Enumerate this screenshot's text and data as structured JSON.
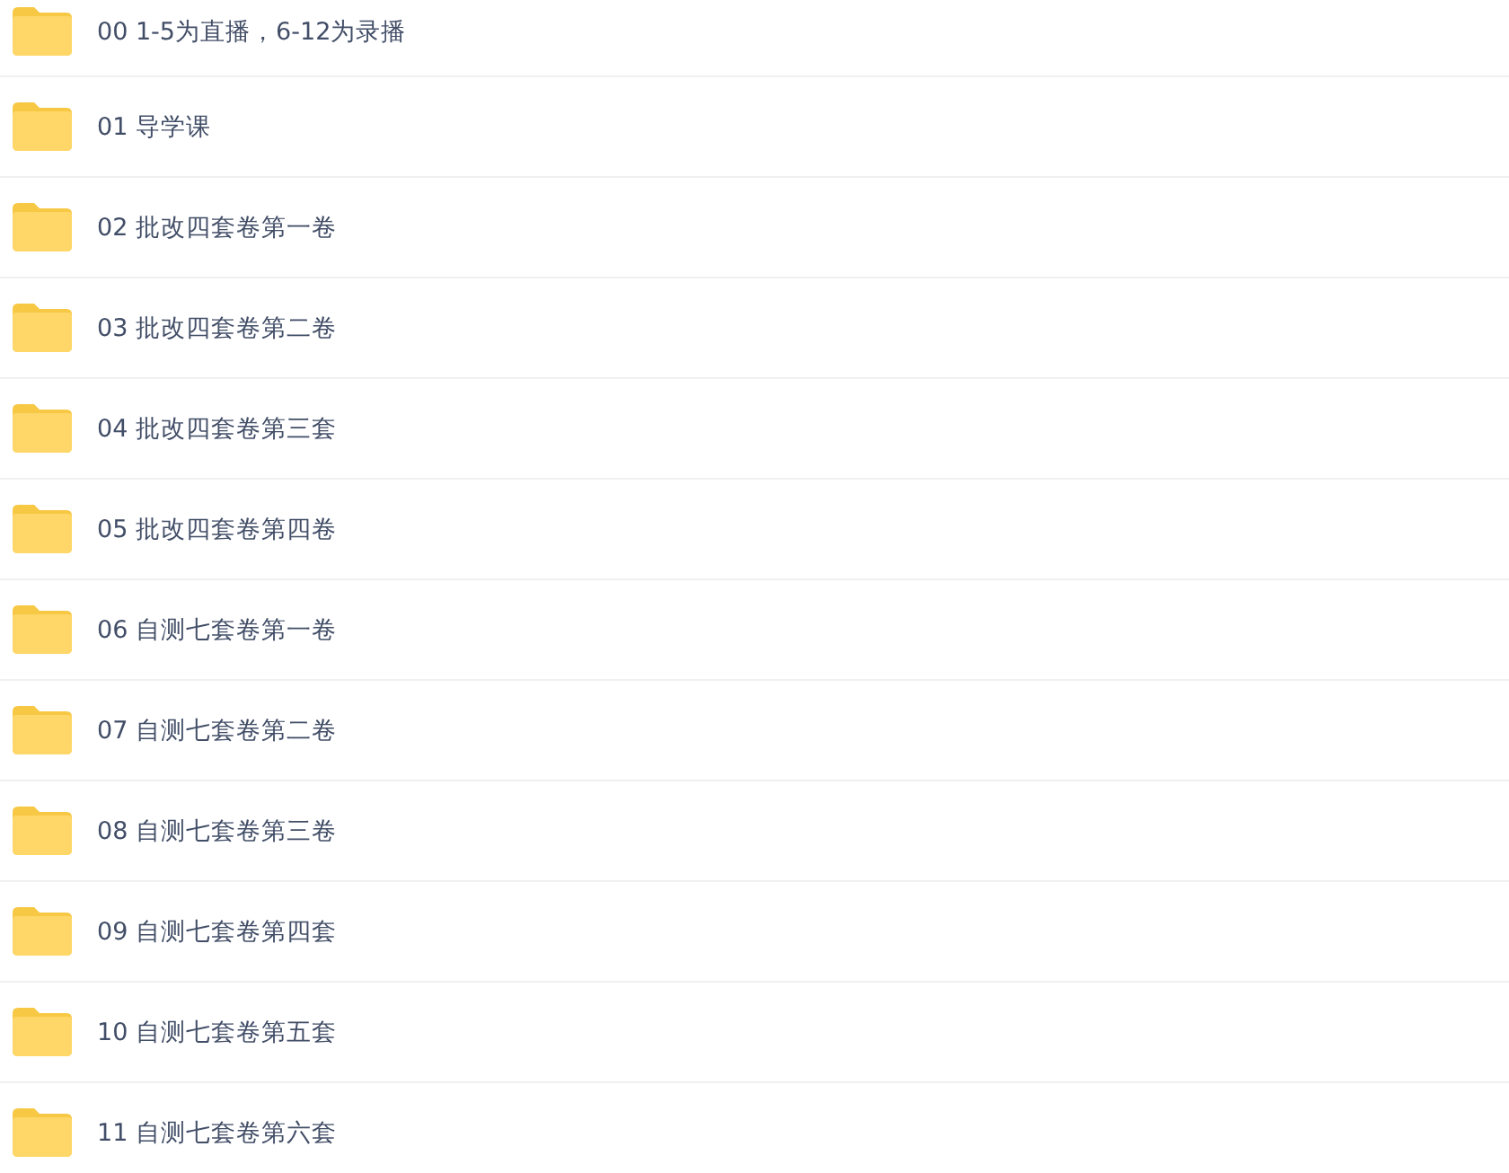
{
  "folders": [
    {
      "name": "00 1-5为直播，6-12为录播"
    },
    {
      "name": "01 导学课"
    },
    {
      "name": "02 批改四套卷第一卷"
    },
    {
      "name": "03 批改四套卷第二卷"
    },
    {
      "name": "04 批改四套卷第三套"
    },
    {
      "name": "05 批改四套卷第四卷"
    },
    {
      "name": "06 自测七套卷第一卷"
    },
    {
      "name": "07 自测七套卷第二卷"
    },
    {
      "name": "08 自测七套卷第三卷"
    },
    {
      "name": "09 自测七套卷第四套"
    },
    {
      "name": "10 自测七套卷第五套"
    },
    {
      "name": "11 自测七套卷第六套"
    }
  ]
}
